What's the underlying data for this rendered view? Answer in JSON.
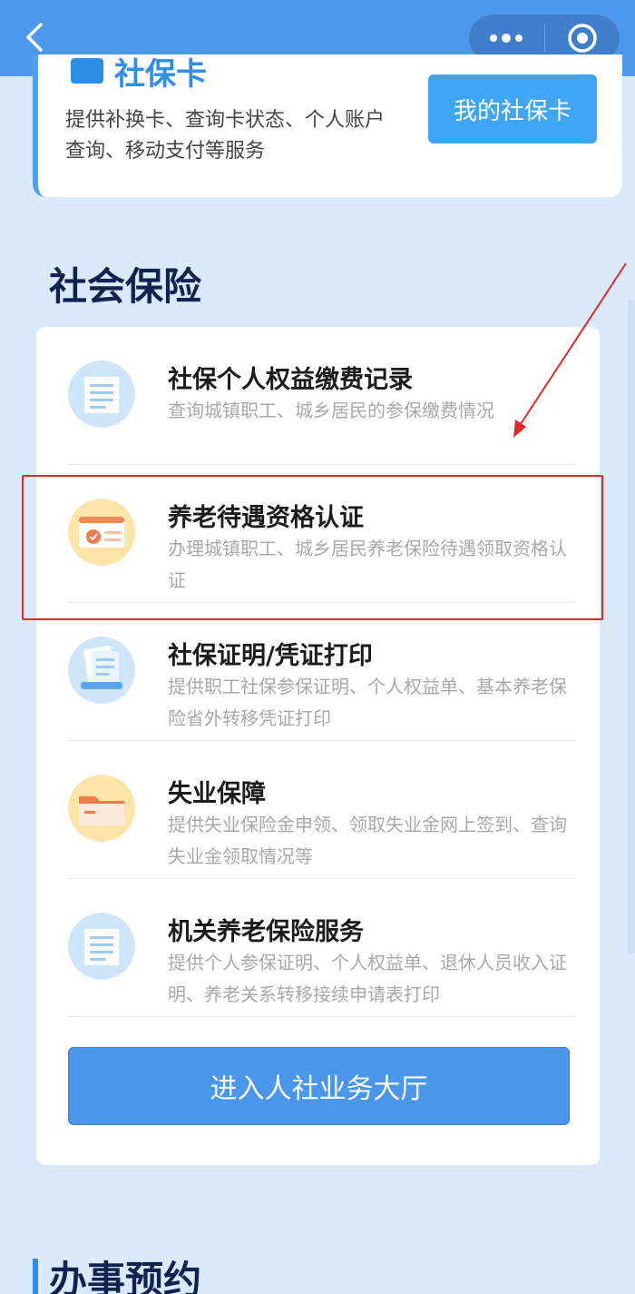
{
  "navbar": {
    "back_icon": "chevron-left-icon",
    "more_icon": "more-dots-icon",
    "close_icon": "target-circle-icon",
    "bg_color": "#4d98ee"
  },
  "card_top": {
    "title": "社保卡",
    "description": "提供补换卡、查询卡状态、个人账户查询、移动支付等服务",
    "button_label": "我的社保卡"
  },
  "section_title": "社会保险",
  "services": [
    {
      "name": "社保个人权益缴费记录",
      "description": "查询城镇职工、城乡居民的参保缴费情况",
      "icon": "document-icon"
    },
    {
      "name": "养老待遇资格认证",
      "description": "办理城镇职工、城乡居民养老保险待遇领取资格认证",
      "icon": "certificate-check-icon"
    },
    {
      "name": "社保证明/凭证打印",
      "description": "提供职工社保参保证明、个人权益单、基本养老保险省外转移凭证打印",
      "icon": "print-documents-icon"
    },
    {
      "name": "失业保障",
      "description": "提供失业保险金申领、领取失业金网上签到、查询失业金领取情况等",
      "icon": "folder-icon"
    },
    {
      "name": "机关养老保险服务",
      "description": "提供个人参保证明、个人权益单、退休人员收入证明、养老关系转移接续申请表打印",
      "icon": "document-icon"
    }
  ],
  "enter_button": "进入人社业务大厅",
  "section2_title": "办事预约",
  "annotation": {
    "highlight_color": "#e02828"
  }
}
